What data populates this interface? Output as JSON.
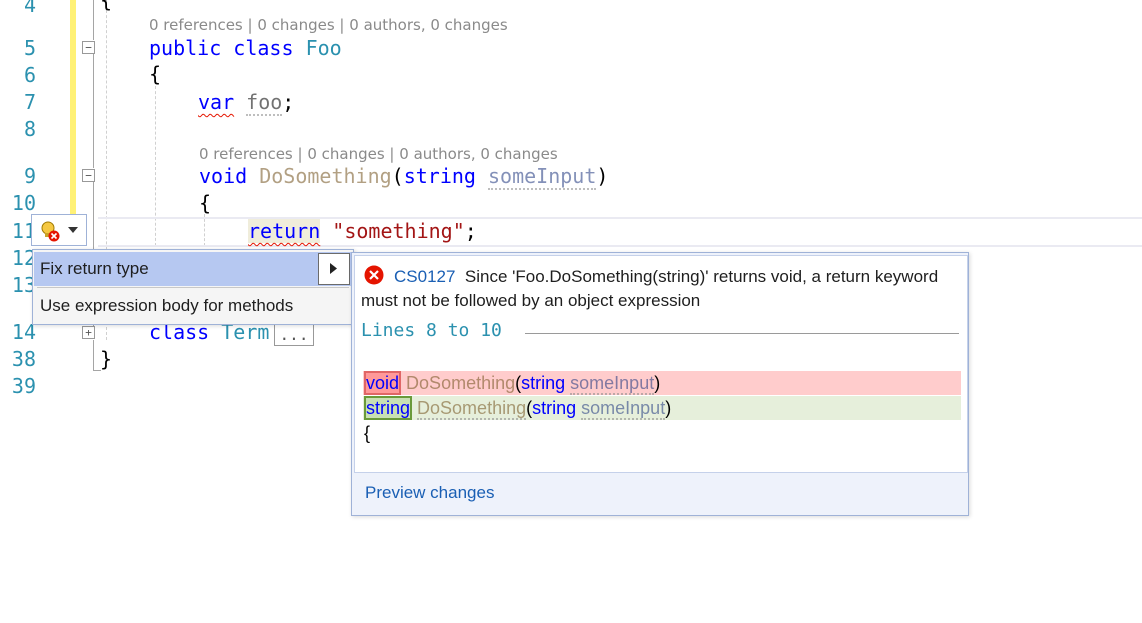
{
  "editor": {
    "line_numbers": [
      "4",
      "5",
      "6",
      "7",
      "8",
      "9",
      "10",
      "11",
      "12",
      "13",
      "14",
      "38",
      "39"
    ],
    "codelens_class": "0 references | 0 changes | 0 authors, 0 changes",
    "codelens_method": "0 references | 0 changes | 0 authors, 0 changes",
    "line4": "{",
    "line5_kw": "public",
    "line5_kw2": "class",
    "line5_name": "Foo",
    "line6": "{",
    "line7_kw": "var",
    "line7_name": "foo",
    "line7_semi": ";",
    "line9_kw": "void",
    "line9_method": "DoSomething",
    "line9_open": "(",
    "line9_type": "string",
    "line9_param": "someInput",
    "line9_close": ")",
    "line10": "{",
    "line11_kw": "return",
    "line11_str": "\"something\"",
    "line11_semi": ";",
    "line14_kw": "class",
    "line14_name": "Term",
    "line14_collapsed": "...",
    "line38": "}"
  },
  "quick_actions": {
    "items": [
      {
        "label": "Fix return type",
        "selected": true
      },
      {
        "label": "Use expression body for methods",
        "selected": false
      }
    ]
  },
  "preview": {
    "error_code": "CS0127",
    "error_message": "Since 'Foo.DoSomething(string)' returns void, a return keyword must not be followed by an object expression",
    "lines_label": "Lines 8 to 10",
    "removed_kw": "void",
    "removed_method": "DoSomething",
    "removed_open": "(",
    "removed_type": "string",
    "removed_param": "someInput",
    "removed_close": ")",
    "added_kw": "string",
    "added_method": "DoSomething",
    "added_open": "(",
    "added_type": "string",
    "added_param": "someInput",
    "added_close": ")",
    "brace": "{",
    "preview_changes_link": "Preview changes"
  },
  "colors": {
    "keyword": "#0000ff",
    "type": "#2b91af",
    "string": "#a31515",
    "error": "#e51400",
    "removed_bg": "#ffcccc",
    "added_bg": "#e6efdb",
    "selection_bg": "#b6c8f1",
    "change_margin": "#fff176"
  },
  "icons": [
    "lightbulb-error-icon",
    "dropdown-arrow-icon",
    "submenu-arrow-icon",
    "error-icon",
    "fold-minus-icon",
    "fold-plus-icon"
  ]
}
